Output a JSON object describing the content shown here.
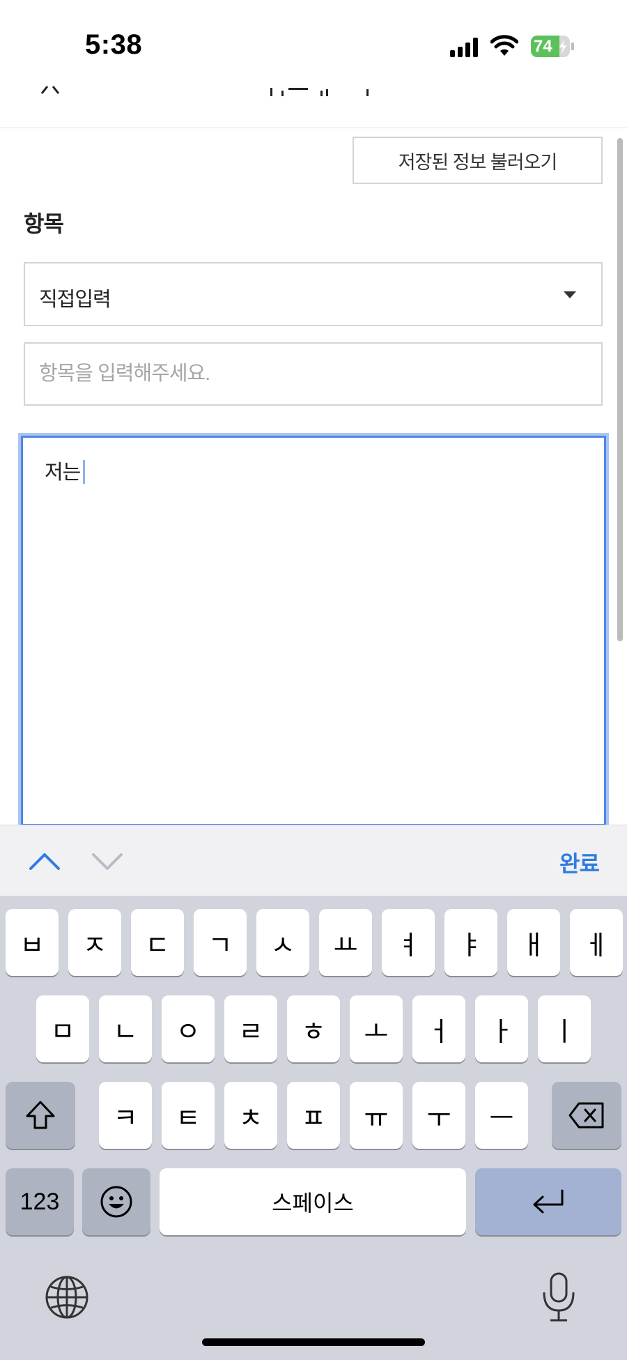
{
  "status_bar": {
    "time": "5:38",
    "battery_percent": "74",
    "battery_level": 0.74,
    "signal_bars": 4
  },
  "main": {
    "load_saved_label": "저장된 정보 불러오기",
    "section_label": "항목",
    "select_value": "직접입력",
    "item_input_placeholder": "항목을 입력해주세요.",
    "item_input_value": "",
    "textarea_value": "저는"
  },
  "keyboard_toolbar": {
    "done_label": "완료"
  },
  "keyboard": {
    "row1": [
      "ㅂ",
      "ㅈ",
      "ㄷ",
      "ㄱ",
      "ㅅ",
      "ㅛ",
      "ㅕ",
      "ㅑ",
      "ㅐ",
      "ㅔ"
    ],
    "row2": [
      "ㅁ",
      "ㄴ",
      "ㅇ",
      "ㄹ",
      "ㅎ",
      "ㅗ",
      "ㅓ",
      "ㅏ",
      "ㅣ"
    ],
    "row3": [
      "ㅋ",
      "ㅌ",
      "ㅊ",
      "ㅍ",
      "ㅠ",
      "ㅜ",
      "ㅡ"
    ],
    "numbers_label": "123",
    "space_label": "스페이스"
  },
  "icons": {
    "shift": "shift-icon",
    "delete": "backspace-icon",
    "emoji": "emoji-icon",
    "return": "return-icon",
    "globe": "globe-icon",
    "mic": "mic-icon",
    "prev": "chevron-up-icon",
    "next": "chevron-down-icon"
  },
  "colors": {
    "accent": "#2f7ce2",
    "focus_border": "#4f86e8",
    "battery_green": "#5cc15a"
  }
}
